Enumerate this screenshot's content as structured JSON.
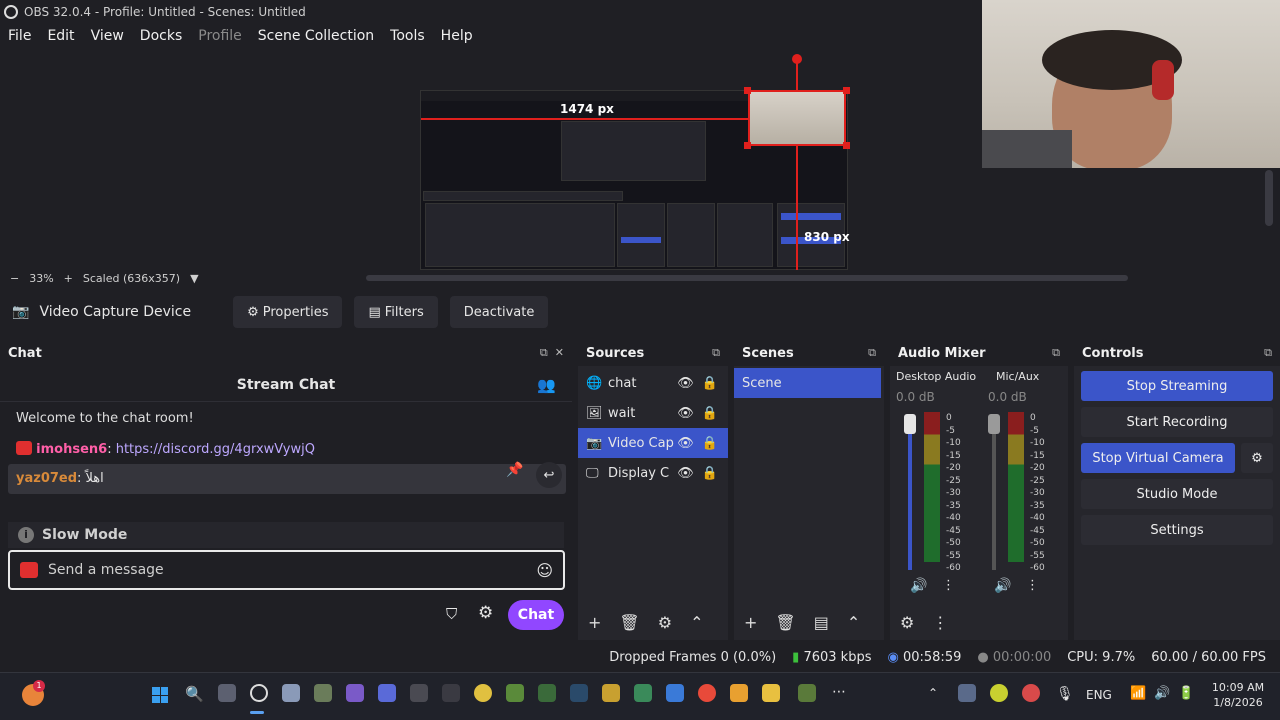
{
  "window": {
    "title": "OBS 32.0.4 - Profile: Untitled - Scenes: Untitled"
  },
  "menu": [
    "File",
    "Edit",
    "View",
    "Docks",
    "Profile",
    "Scene Collection",
    "Tools",
    "Help"
  ],
  "preview": {
    "width_label": "1474 px",
    "height_label": "830 px",
    "zoom": "33%",
    "scaled": "Scaled (636x357)"
  },
  "source_toolbar": {
    "source_name": "Video Capture Device",
    "properties": "Properties",
    "filters": "Filters",
    "deactivate": "Deactivate"
  },
  "chat": {
    "dock_title": "Chat",
    "header": "Stream Chat",
    "welcome": "Welcome to the chat room!",
    "msg1_user": "imohsen6",
    "msg1_text": "https://discord.gg/4grxwVywjQ",
    "msg2_user": "yaz07ed",
    "msg2_text": "اهلاً",
    "slow_mode": "Slow Mode",
    "input_placeholder": "Send a message",
    "send_label": "Chat"
  },
  "sources": {
    "title": "Sources",
    "items": [
      {
        "name": "chat",
        "selected": false
      },
      {
        "name": "wait",
        "selected": false
      },
      {
        "name": "Video Cap",
        "selected": true
      },
      {
        "name": "Display C",
        "selected": false
      }
    ]
  },
  "scenes": {
    "title": "Scenes",
    "items": [
      "Scene"
    ]
  },
  "mixer": {
    "title": "Audio Mixer",
    "channels": [
      {
        "name": "Desktop Audio",
        "level": "0.0 dB"
      },
      {
        "name": "Mic/Aux",
        "level": "0.0 dB"
      }
    ],
    "scale": [
      "0",
      "-5",
      "-10",
      "-15",
      "-20",
      "-25",
      "-30",
      "-35",
      "-40",
      "-45",
      "-50",
      "-55",
      "-60"
    ]
  },
  "controls": {
    "title": "Controls",
    "stop_streaming": "Stop Streaming",
    "start_recording": "Start Recording",
    "stop_virtual_camera": "Stop Virtual Camera",
    "studio_mode": "Studio Mode",
    "settings": "Settings"
  },
  "status": {
    "dropped_frames": "Dropped Frames 0 (0.0%)",
    "bitrate": "7603 kbps",
    "stream_time": "00:58:59",
    "rec_time": "00:00:00",
    "cpu": "CPU: 9.7%",
    "fps": "60.00 / 60.00 FPS"
  },
  "taskbar": {
    "lang": "ENG",
    "time": "10:09 AM",
    "date": "1/8/2026",
    "badge": "1"
  },
  "colors": {
    "accent": "#3b55c9",
    "chat_button": "#9147ff",
    "guide_red": "#e0201d"
  }
}
